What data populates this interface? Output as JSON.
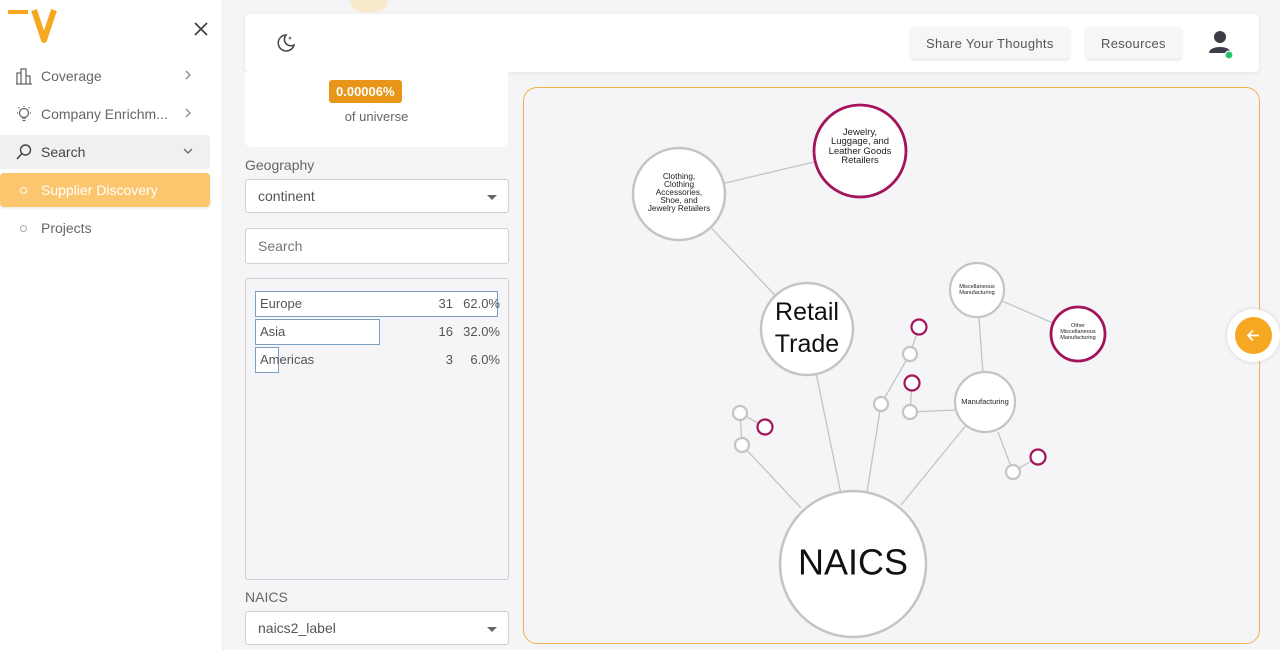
{
  "sidebar": {
    "items": [
      {
        "label": "Coverage"
      },
      {
        "label": "Company Enrichm..."
      },
      {
        "label": "Search"
      },
      {
        "label": "Supplier Discovery"
      },
      {
        "label": "Projects"
      }
    ]
  },
  "header": {
    "share_label": "Share Your Thoughts",
    "resources_label": "Resources"
  },
  "stats": {
    "percent": "0.00006%",
    "universe_label": "of universe"
  },
  "filters": {
    "geography_label": "Geography",
    "geography_value": "continent",
    "search_placeholder": "Search",
    "rows": [
      {
        "name": "Europe",
        "count": "31",
        "pct": "62.0%",
        "share": 1.0
      },
      {
        "name": "Asia",
        "count": "16",
        "pct": "32.0%",
        "share": 0.516
      },
      {
        "name": "Americas",
        "count": "3",
        "pct": "6.0%",
        "share": 0.097
      }
    ],
    "naics_label": "NAICS",
    "naics_value": "naics2_label"
  },
  "graph": {
    "nodes": {
      "naics": "NAICS",
      "retail": "Retail Trade",
      "clothing": "Clothing, Clothing Accessories, Shoe, and Jewelry Retailers",
      "jewelry": "Jewelry, Luggage, and Leather Goods Retailers",
      "misc": "Miscellaneous Manufacturing",
      "other_misc": "Other Miscellaneous Manufacturing",
      "manufacturing": "Manufacturing"
    }
  },
  "colors": {
    "accent": "#f7a823",
    "highlight_node": "#a3145a",
    "node_stroke": "#c4c4c4"
  }
}
